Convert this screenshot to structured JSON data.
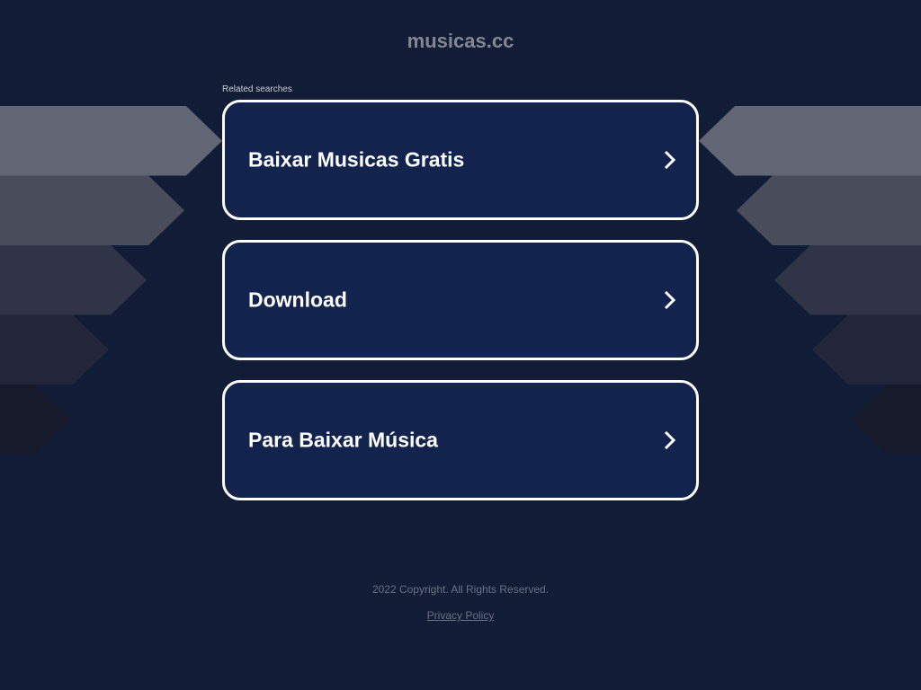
{
  "header": {
    "title": "musicas.cc"
  },
  "related_label": "Related searches",
  "links": [
    {
      "label": "Baixar Musicas Gratis",
      "icon": "chevron-right-icon"
    },
    {
      "label": "Download",
      "icon": "chevron-right-icon"
    },
    {
      "label": "Para Baixar Música",
      "icon": "chevron-right-icon"
    }
  ],
  "footer": {
    "copyright": "2022 Copyright. All Rights Reserved.",
    "privacy": "Privacy Policy"
  },
  "colors": {
    "background": "#111c36",
    "card": "#12244d",
    "card_border": "#ffffff",
    "arrows": [
      "#626573",
      "#494c5b",
      "#303446",
      "#222638",
      "#161a2b"
    ]
  }
}
